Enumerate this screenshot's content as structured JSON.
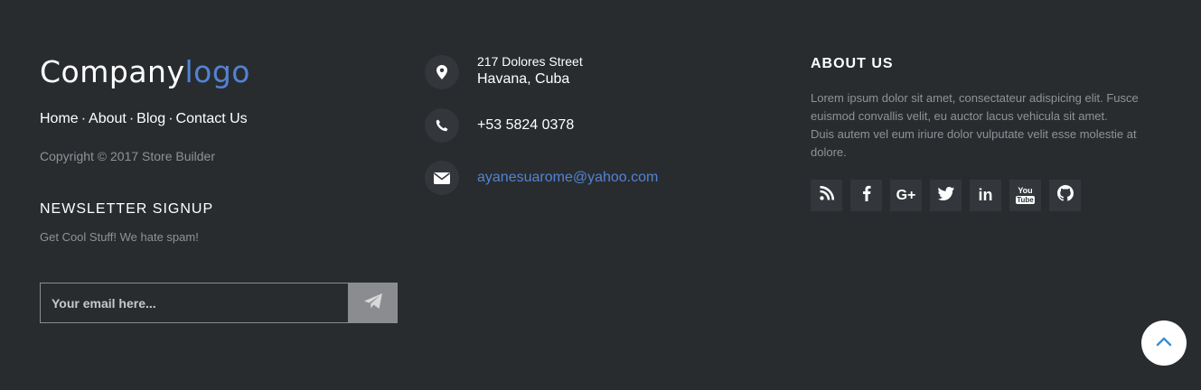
{
  "brand": {
    "logo_part1": "Company",
    "logo_part2": "logo",
    "accent_color": "#5383d3"
  },
  "nav": {
    "links": [
      "Home",
      "About",
      "Blog",
      "Contact Us"
    ],
    "separator": "·"
  },
  "copyright": "Copyright © 2017 Store Builder",
  "newsletter": {
    "title": "NEWSLETTER SIGNUP",
    "subtitle": "Get Cool Stuff! We hate spam!",
    "placeholder": "Your email here...",
    "submit_icon": "paper-plane-icon"
  },
  "contact": {
    "address_line1": "217 Dolores Street",
    "address_line2": "Havana, Cuba",
    "address_icon": "map-marker-icon",
    "phone": "+53 5824 0378",
    "phone_icon": "phone-icon",
    "email": "ayanesuarome@yahoo.com",
    "email_icon": "envelope-icon"
  },
  "about": {
    "title": "ABOUT US",
    "text_line1": "Lorem ipsum dolor sit amet, consectateur adispicing elit. Fusce euismod convallis velit, eu auctor lacus vehicula sit amet.",
    "text_line2": "Duis autem vel eum iriure dolor vulputate velit esse molestie at dolore."
  },
  "socials": [
    {
      "name": "rss-icon"
    },
    {
      "name": "facebook-icon"
    },
    {
      "name": "google-plus-icon",
      "label": "G+"
    },
    {
      "name": "twitter-icon"
    },
    {
      "name": "linkedin-icon",
      "label": "in"
    },
    {
      "name": "youtube-icon",
      "label_top": "You",
      "label_bottom": "Tube"
    },
    {
      "name": "github-icon"
    }
  ],
  "back_to_top_icon": "chevron-up-icon",
  "colors": {
    "background": "#292c2f",
    "icon_bg": "#33363a",
    "muted_text": "#8f9296",
    "back_to_top_arrow": "#3a8fd0"
  }
}
